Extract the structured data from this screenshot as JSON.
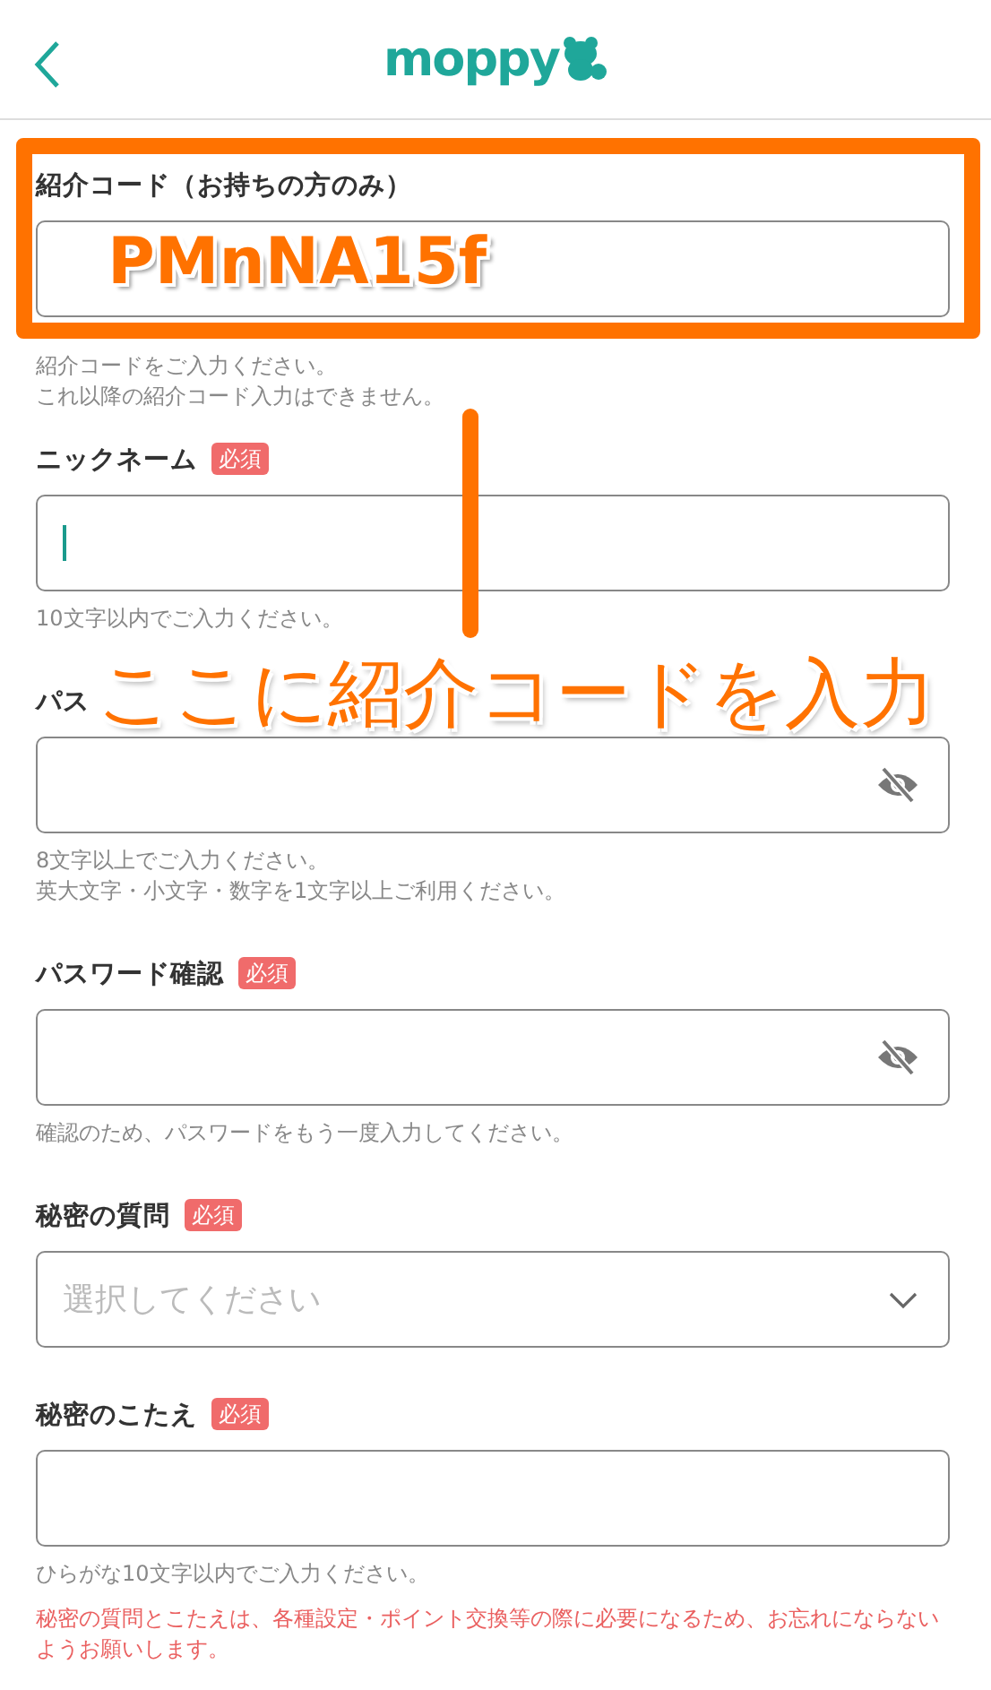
{
  "header": {
    "logo": "moppy"
  },
  "referral": {
    "label": "紹介コード（お持ちの方のみ）",
    "hints": [
      "紹介コードをご入力ください。",
      "これ以降の紹介コード入力はできません。"
    ]
  },
  "fields": [
    {
      "kind": "text",
      "label": "ニックネーム",
      "badge": "必須",
      "focused": true,
      "hints": [
        "10文字以内でご入力ください。"
      ]
    },
    {
      "kind": "password",
      "label": "パス",
      "focused": false,
      "hints": [
        "8文字以上でご入力ください。",
        "英大文字・小文字・数字を1文字以上ご利用ください。"
      ]
    },
    {
      "kind": "password",
      "label": "パスワード確認",
      "badge": "必須",
      "focused": false,
      "hints": [
        "確認のため、パスワードをもう一度入力してください。"
      ]
    },
    {
      "kind": "select",
      "label": "秘密の質問",
      "badge": "必須",
      "focused": false,
      "placeholder": "選択してください"
    },
    {
      "kind": "text",
      "label": "秘密のこたえ",
      "badge": "必須",
      "focused": false,
      "hints": [
        "ひらがな10文字以内でご入力ください。"
      ],
      "note": "秘密の質問とこたえは、各種設定・ポイント交換等の際に必要になるため、お忘れにならないようお願いします。"
    }
  ],
  "annotation": {
    "code": "PMnNA15f",
    "caption": "ここに紹介コードを入力"
  }
}
